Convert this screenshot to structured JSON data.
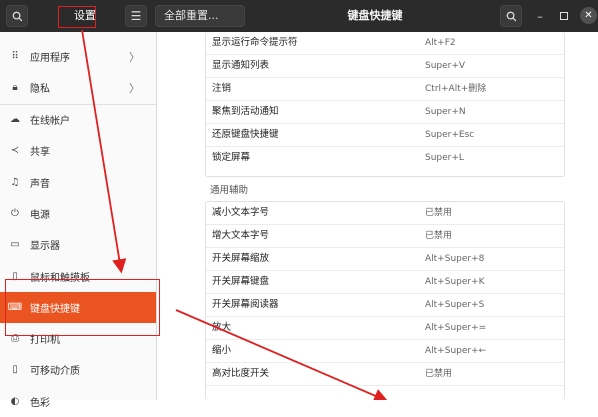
{
  "titlebar": {
    "search_icon": "search-icon",
    "title": "设置",
    "menu_icon": "hamburger-icon",
    "reset_label": "全部重置...",
    "window_title": "键盘快捷键",
    "right_search_icon": "search-icon",
    "minimize_icon": "minimize-icon",
    "maximize_icon": "maximize-icon",
    "close_icon": "close-icon"
  },
  "sidebar": {
    "items": [
      {
        "label": "应用程序",
        "icon": "apps-grid-icon",
        "chevron": true
      },
      {
        "label": "隐私",
        "icon": "lock-icon",
        "chevron": true
      },
      {
        "label": "在线帐户",
        "icon": "cloud-icon",
        "chevron": false
      },
      {
        "label": "共享",
        "icon": "share-icon",
        "chevron": false
      },
      {
        "label": "声音",
        "icon": "music-note-icon",
        "chevron": false
      },
      {
        "label": "电源",
        "icon": "power-icon",
        "chevron": false
      },
      {
        "label": "显示器",
        "icon": "monitor-icon",
        "chevron": false
      },
      {
        "label": "鼠标和触摸板",
        "icon": "mouse-icon",
        "chevron": false
      },
      {
        "label": "键盘快捷键",
        "icon": "keyboard-icon",
        "chevron": false,
        "active": true
      },
      {
        "label": "打印机",
        "icon": "printer-icon",
        "chevron": false
      },
      {
        "label": "可移动介质",
        "icon": "usb-drive-icon",
        "chevron": false
      },
      {
        "label": "色彩",
        "icon": "color-icon",
        "chevron": false
      }
    ]
  },
  "shortcuts_top": [
    {
      "name": "显示运行命令提示符",
      "key": "Alt+F2"
    },
    {
      "name": "显示通知列表",
      "key": "Super+V"
    },
    {
      "name": "注销",
      "key": "Ctrl+Alt+删除"
    },
    {
      "name": "聚焦到活动通知",
      "key": "Super+N"
    },
    {
      "name": "还原键盘快捷键",
      "key": "Super+Esc"
    },
    {
      "name": "锁定屏幕",
      "key": "Super+L"
    }
  ],
  "section_accessibility": "通用辅助",
  "shortcuts_access": [
    {
      "name": "减小文本字号",
      "key": "已禁用"
    },
    {
      "name": "增大文本字号",
      "key": "已禁用"
    },
    {
      "name": "开关屏幕缩放",
      "key": "Alt+Super+8"
    },
    {
      "name": "开关屏幕键盘",
      "key": "Alt+Super+K"
    },
    {
      "name": "开关屏幕阅读器",
      "key": "Alt+Super+S"
    },
    {
      "name": "放大",
      "key": "Alt+Super+="
    },
    {
      "name": "缩小",
      "key": "Alt+Super+←"
    },
    {
      "name": "高对比度开关",
      "key": "已禁用"
    }
  ],
  "colors": {
    "accent": "#e95420",
    "annotation": "#e02020",
    "titlebar": "#2b2b2b"
  }
}
